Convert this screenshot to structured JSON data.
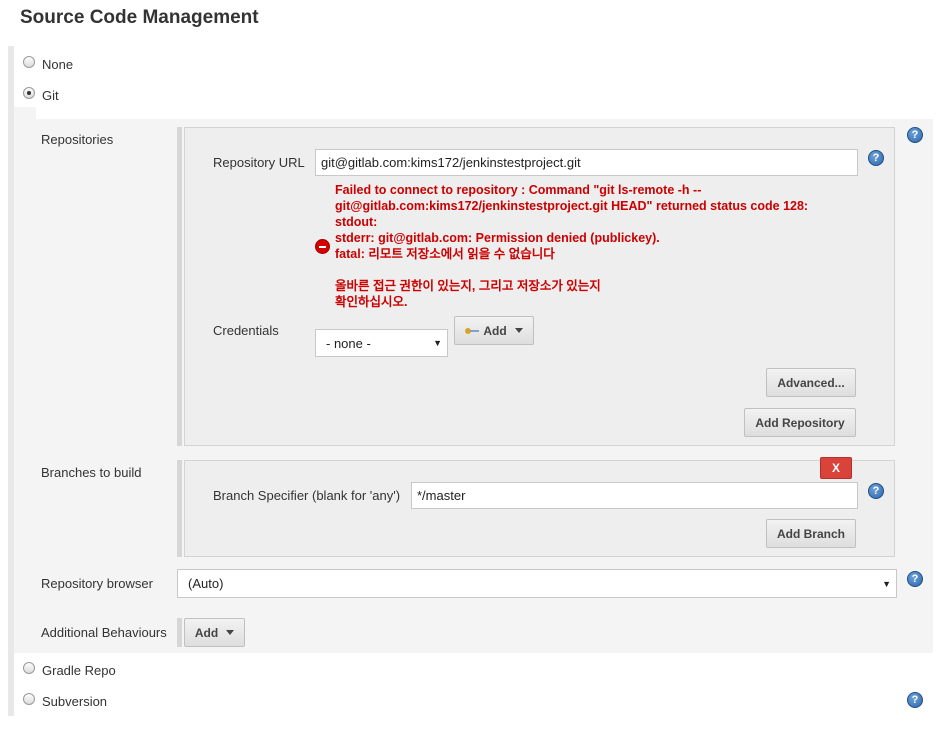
{
  "section_title": "Source Code Management",
  "scm_options": {
    "none": "None",
    "git": "Git",
    "gradle": "Gradle Repo",
    "subversion": "Subversion"
  },
  "repositories": {
    "label": "Repositories",
    "url_label": "Repository URL",
    "url_value": "git@gitlab.com:kims172/jenkinstestproject.git",
    "error_lines": [
      "Failed to connect to repository : Command \"git ls-remote -h --",
      "git@gitlab.com:kims172/jenkinstestproject.git HEAD\" returned status code 128:",
      "stdout:",
      "stderr: git@gitlab.com: Permission denied (publickey).",
      "fatal: 리모트 저장소에서 읽을 수 없습니다",
      "",
      "올바른 접근 권한이 있는지, 그리고 저장소가 있는지",
      "확인하십시오."
    ],
    "credentials_label": "Credentials",
    "credentials_value": "- none -",
    "add_label": "Add",
    "advanced_label": "Advanced...",
    "add_repository_label": "Add Repository"
  },
  "branches": {
    "label": "Branches to build",
    "delete_label": "X",
    "specifier_label": "Branch Specifier (blank for 'any')",
    "specifier_value": "*/master",
    "add_branch_label": "Add Branch"
  },
  "repo_browser": {
    "label": "Repository browser",
    "value": "(Auto)"
  },
  "behaviours": {
    "label": "Additional Behaviours",
    "add_label": "Add"
  },
  "help_glyph": "?",
  "colors": {
    "error": "#cc0000",
    "help": "#2c66ab",
    "delete": "#d9433a"
  }
}
